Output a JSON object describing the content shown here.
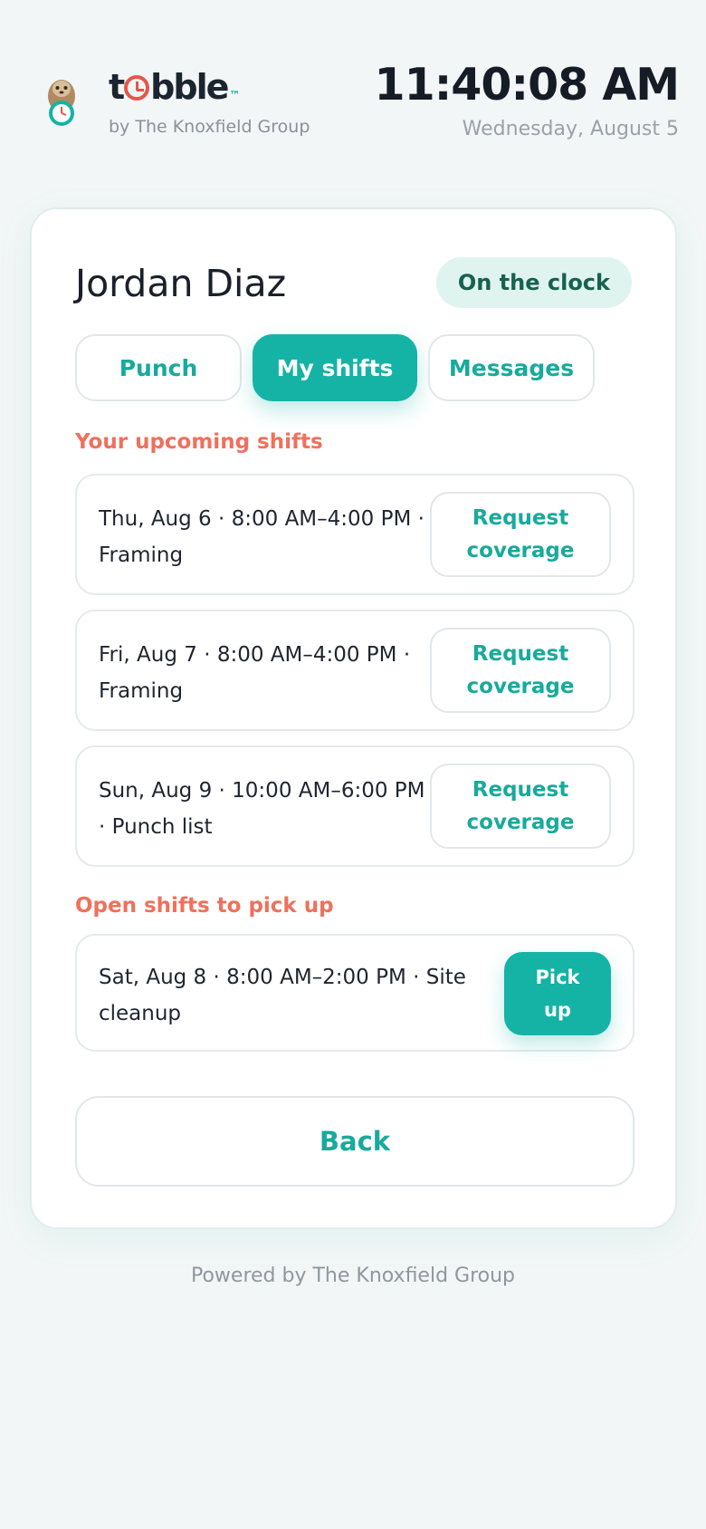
{
  "brand": {
    "name_prefix": "t",
    "name_suffix": "bble",
    "trademark": "™",
    "subtitle": "by The Knoxfield Group"
  },
  "clock": {
    "time": "11:40:08 AM",
    "date": "Wednesday, August 5"
  },
  "employee": {
    "name": "Jordan Diaz",
    "status": "On the clock"
  },
  "tabs": [
    {
      "label": "Punch",
      "active": false
    },
    {
      "label": "My shifts",
      "active": true
    },
    {
      "label": "Messages",
      "active": false
    }
  ],
  "upcoming": {
    "title": "Your upcoming shifts",
    "action_label": "Request coverage",
    "shifts": [
      {
        "text": "Thu, Aug 6 · 8:00 AM–4:00 PM · Framing"
      },
      {
        "text": "Fri, Aug 7 · 8:00 AM–4:00 PM · Framing"
      },
      {
        "text": "Sun, Aug 9 · 10:00 AM–6:00 PM · Punch list"
      }
    ]
  },
  "open": {
    "title": "Open shifts to pick up",
    "action_label": "Pick up",
    "shifts": [
      {
        "text": "Sat, Aug 8 · 8:00 AM–2:00 PM · Site cleanup"
      }
    ]
  },
  "back_label": "Back",
  "footer": "Powered by The Knoxfield Group",
  "colors": {
    "accent": "#14b3a6",
    "section_title": "#f0705c",
    "status_bg": "#dff3ef",
    "status_text": "#17614f"
  }
}
